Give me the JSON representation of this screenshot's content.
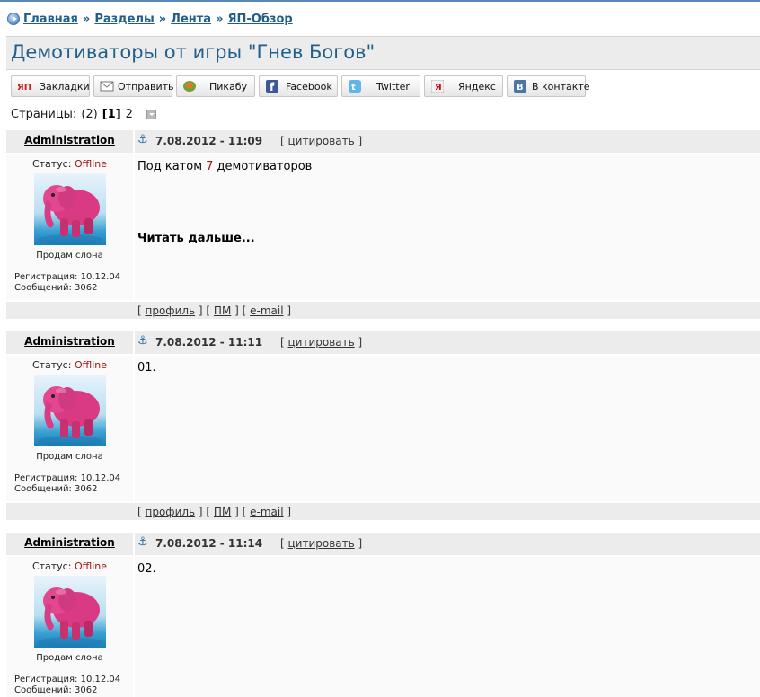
{
  "breadcrumb": {
    "items": [
      "Главная",
      "Разделы",
      "Лента",
      "ЯП-Обзор"
    ],
    "separator": "»"
  },
  "page_title": "Демотиваторы от игры \"Гнев Богов\"",
  "share": {
    "buttons": [
      {
        "label": "Закладки",
        "icon": "yap-icon"
      },
      {
        "label": "Отправить",
        "icon": "mail-icon"
      },
      {
        "label": "Пикабу",
        "icon": "pikabu-icon"
      },
      {
        "label": "Facebook",
        "icon": "facebook-icon"
      },
      {
        "label": "Twitter",
        "icon": "twitter-icon"
      },
      {
        "label": "Яндекс",
        "icon": "yandex-icon"
      },
      {
        "label": "В контакте",
        "icon": "vkontakte-icon"
      }
    ]
  },
  "pagination": {
    "label": "Страницы:",
    "count": "(2)",
    "current": "[1]",
    "next": "2"
  },
  "posts": [
    {
      "author": "Administration",
      "date": "7.08.2012 - 11:09",
      "quote_label": "цитировать",
      "status_label": "Статус:",
      "status_value": "Offline",
      "avatar_caption": "Продам слона",
      "registration": "Регистрация: 10.12.04",
      "messages": "Сообщений: 3062",
      "text_before": "Под катом ",
      "text_number": "7",
      "text_after": " демотиваторов",
      "read_more": "Читать дальше...",
      "footer": {
        "profile": "профиль",
        "pm": "ПМ",
        "email": "e-mail"
      }
    },
    {
      "author": "Administration",
      "date": "7.08.2012 - 11:11",
      "quote_label": "цитировать",
      "status_label": "Статус:",
      "status_value": "Offline",
      "avatar_caption": "Продам слона",
      "registration": "Регистрация: 10.12.04",
      "messages": "Сообщений: 3062",
      "text": "01.",
      "footer": {
        "profile": "профиль",
        "pm": "ПМ",
        "email": "e-mail"
      }
    },
    {
      "author": "Administration",
      "date": "7.08.2012 - 11:14",
      "quote_label": "цитировать",
      "status_label": "Статус:",
      "status_value": "Offline",
      "avatar_caption": "Продам слона",
      "registration": "Регистрация: 10.12.04",
      "messages": "Сообщений: 3062",
      "text": "02."
    }
  ],
  "colors": {
    "link_blue": "#1f5e8c",
    "offline_red": "#a01010",
    "header_gray": "#ececec"
  }
}
